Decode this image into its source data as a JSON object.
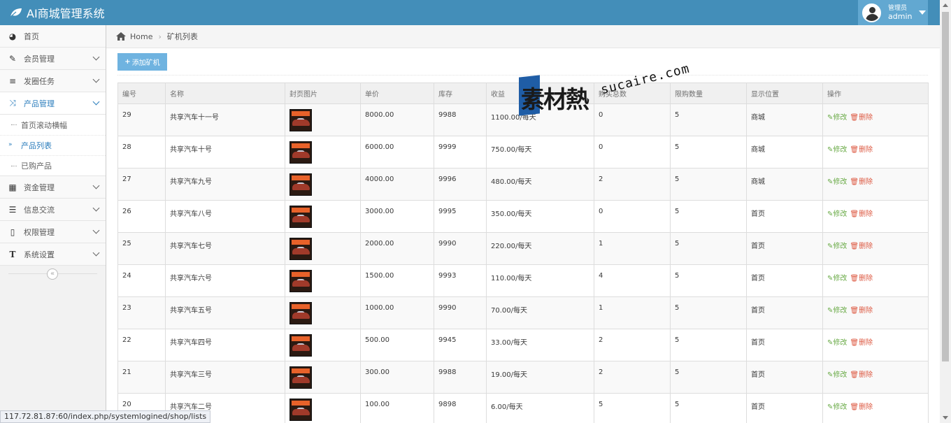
{
  "header": {
    "title": "AI商城管理系统",
    "user_role": "管理员",
    "user_name": "admin"
  },
  "sidebar": {
    "items": [
      {
        "label": "首页",
        "icon": "dashboard-icon"
      },
      {
        "label": "会员管理",
        "icon": "edit-icon"
      },
      {
        "label": "发圈任务",
        "icon": "list-icon"
      },
      {
        "label": "产品管理",
        "icon": "shuffle-icon"
      },
      {
        "label": "资金管理",
        "icon": "calendar-icon"
      },
      {
        "label": "信息交流",
        "icon": "list-alt-icon"
      },
      {
        "label": "权限管理",
        "icon": "file-icon"
      },
      {
        "label": "系统设置",
        "icon": "text-icon"
      }
    ],
    "subitems": [
      {
        "label": "首页滚动横幅"
      },
      {
        "label": "产品列表"
      },
      {
        "label": "已购产品"
      }
    ]
  },
  "breadcrumb": {
    "home": "Home",
    "current": "矿机列表"
  },
  "toolbar": {
    "add_label": "添加矿机"
  },
  "table": {
    "headers": [
      "编号",
      "名称",
      "封页图片",
      "单价",
      "库存",
      "收益",
      "购买总数",
      "限购数量",
      "显示位置",
      "操作"
    ],
    "edit_label": "修改",
    "delete_label": "删除",
    "thumb_text": "国家共享",
    "rows": [
      {
        "id": "29",
        "name": "共享汽车十一号",
        "price": "8000.00",
        "stock": "9988",
        "income": "1100.00/每天",
        "total": "0",
        "limit": "5",
        "position": "商城"
      },
      {
        "id": "28",
        "name": "共享汽车十号",
        "price": "6000.00",
        "stock": "9999",
        "income": "750.00/每天",
        "total": "0",
        "limit": "5",
        "position": "商城"
      },
      {
        "id": "27",
        "name": "共享汽车九号",
        "price": "4000.00",
        "stock": "9996",
        "income": "480.00/每天",
        "total": "2",
        "limit": "5",
        "position": "商城"
      },
      {
        "id": "26",
        "name": "共享汽车八号",
        "price": "3000.00",
        "stock": "9995",
        "income": "350.00/每天",
        "total": "0",
        "limit": "5",
        "position": "首页"
      },
      {
        "id": "25",
        "name": "共享汽车七号",
        "price": "2000.00",
        "stock": "9990",
        "income": "220.00/每天",
        "total": "1",
        "limit": "5",
        "position": "首页"
      },
      {
        "id": "24",
        "name": "共享汽车六号",
        "price": "1500.00",
        "stock": "9993",
        "income": "110.00/每天",
        "total": "4",
        "limit": "5",
        "position": "首页"
      },
      {
        "id": "23",
        "name": "共享汽车五号",
        "price": "1000.00",
        "stock": "9990",
        "income": "70.00/每天",
        "total": "1",
        "limit": "5",
        "position": "首页"
      },
      {
        "id": "22",
        "name": "共享汽车四号",
        "price": "500.00",
        "stock": "9945",
        "income": "33.00/每天",
        "total": "2",
        "limit": "5",
        "position": "首页"
      },
      {
        "id": "21",
        "name": "共享汽车三号",
        "price": "300.00",
        "stock": "9988",
        "income": "19.00/每天",
        "total": "2",
        "limit": "5",
        "position": "首页"
      },
      {
        "id": "20",
        "name": "共享汽车二号",
        "price": "100.00",
        "stock": "9898",
        "income": "6.00/每天",
        "total": "5",
        "limit": "5",
        "position": "首页"
      }
    ]
  },
  "watermark": {
    "cn": "素材熱",
    "en": "sucaire.com"
  },
  "status_url": "117.72.81.87:60/index.php/systemlogined/shop/lists",
  "colors": {
    "navbar": "#438eb9",
    "accent": "#2b7dbc",
    "edit": "#69aa46",
    "delete": "#dd5a43",
    "add_button": "#6fb3e0"
  }
}
